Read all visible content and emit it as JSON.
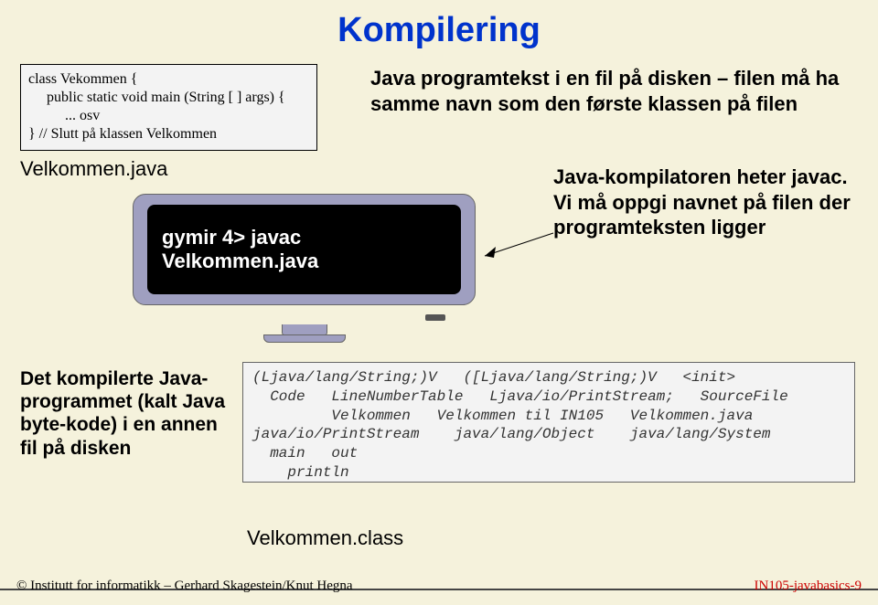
{
  "title": "Kompilering",
  "codebox": {
    "line1": "class Vekommen {",
    "line2": "public static void main (String [ ] args) {",
    "line3": "... osv",
    "line4": "} // Slutt på klassen Velkommen"
  },
  "filename_source": "Velkommen.java",
  "right_text_1": "Java programtekst i en fil på disken – filen må ha samme navn som den første klassen på filen",
  "terminal_cmd": "gymir 4> javac Velkommen.java",
  "right_text_2": "Java-kompilatoren heter javac.\nVi må oppgi navnet på filen der programteksten ligger",
  "left_lower_text": "Det kompilerte Java-programmet (kalt Java byte-kode) i en annen fil på disken",
  "bytecode": "(Ljava/lang/String;)V   ([Ljava/lang/String;)V   <init>\n  Code   LineNumberTable   Ljava/io/PrintStream;   SourceFile\n         Velkommen   Velkommen til IN105   Velkommen.java\njava/io/PrintStream    java/lang/Object    java/lang/System\n  main   out\n    println",
  "filename_output": "Velkommen.class",
  "footer_left": "© Institutt for informatikk – Gerhard Skagestein/Knut Hegna",
  "footer_right": "IN105-javabasics-9"
}
